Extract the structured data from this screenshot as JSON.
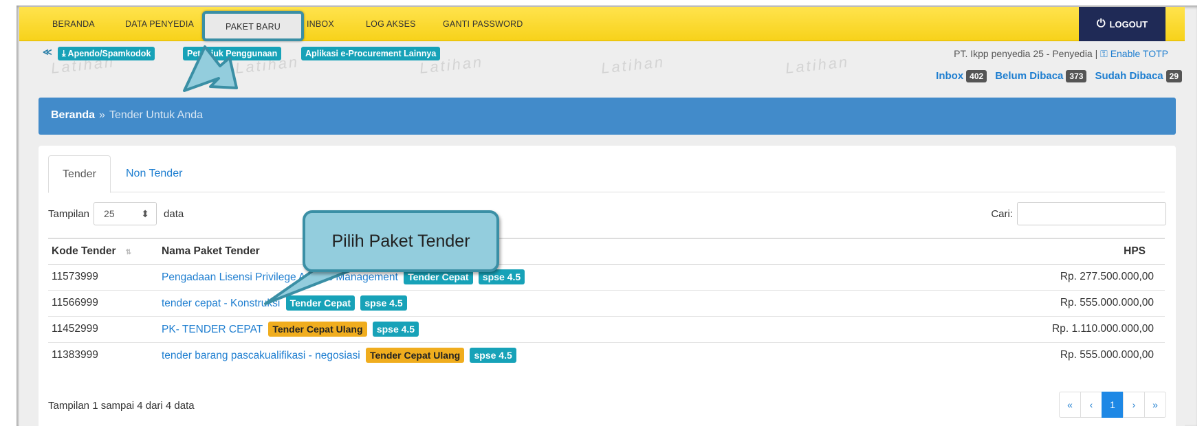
{
  "nav": {
    "items": [
      "BERANDA",
      "DATA PENYEDIA",
      "PAKET BARU",
      "INBOX",
      "LOG AKSES",
      "GANTI PASSWORD"
    ],
    "logout_label": "LOGOUT",
    "logout_icon": "power-icon"
  },
  "subbar": {
    "chevron_icon": "chevron-up-double-icon",
    "link1": "Apendo/Spamkodok",
    "link1_icon": "download-icon",
    "link2": "Petunjuk Penggunaan",
    "link3": "Aplikasi e-Procurement Lainnya",
    "user_text": "PT. Ikpp penyedia 25 - Penyedia |",
    "totp_label": "Enable TOTP",
    "totp_icon": "key-icon"
  },
  "watermark": "Latihan",
  "inbox": {
    "inbox_label": "Inbox",
    "inbox_count": "402",
    "unread_label": "Belum Dibaca",
    "unread_count": "373",
    "read_label": "Sudah Dibaca",
    "read_count": "29"
  },
  "breadcrumb": {
    "root": "Beranda",
    "separator": "»",
    "current": "Tender Untuk Anda"
  },
  "tabs": [
    "Tender",
    "Non Tender"
  ],
  "table_controls": {
    "show_label": "Tampilan",
    "page_size": "25",
    "data_label": "data",
    "search_label": "Cari:",
    "search_value": ""
  },
  "table": {
    "headers": [
      "Kode Tender",
      "Nama Paket Tender",
      "HPS"
    ],
    "rows": [
      {
        "kode": "11573999",
        "nama": "Pengadaan Lisensi Privilege Access Management",
        "label": "Tender Cepat",
        "label_type": "cepat",
        "spse": "spse 4.5",
        "hps": "Rp. 277.500.000,00"
      },
      {
        "kode": "11566999",
        "nama": "tender cepat - Konstruksi",
        "label": "Tender Cepat",
        "label_type": "cepat",
        "spse": "spse 4.5",
        "hps": "Rp. 555.000.000,00"
      },
      {
        "kode": "11452999",
        "nama": "PK- TENDER CEPAT",
        "label": "Tender Cepat Ulang",
        "label_type": "ulang",
        "spse": "spse 4.5",
        "hps": "Rp. 1.110.000.000,00"
      },
      {
        "kode": "11383999",
        "nama": "tender barang pascakualifikasi - negosiasi",
        "label": "Tender Cepat Ulang",
        "label_type": "ulang",
        "spse": "spse 4.5",
        "hps": "Rp. 555.000.000,00"
      }
    ]
  },
  "footer": {
    "info": "Tampilan 1 sampai 4 dari 4 data",
    "pager": [
      "«",
      "‹",
      "1",
      "›",
      "»"
    ],
    "current_page": "1"
  },
  "annotation": {
    "callout_text": "Pilih Paket Tender"
  },
  "colors": {
    "nav_yellow": "#f7d21a",
    "logout_navy": "#1f2a56",
    "breadcrumb_blue": "#428bca",
    "tag_teal": "#17a2b8",
    "label_orange": "#f0ad1e",
    "callout_fill": "#93cddd",
    "callout_border": "#3a8fa5"
  }
}
